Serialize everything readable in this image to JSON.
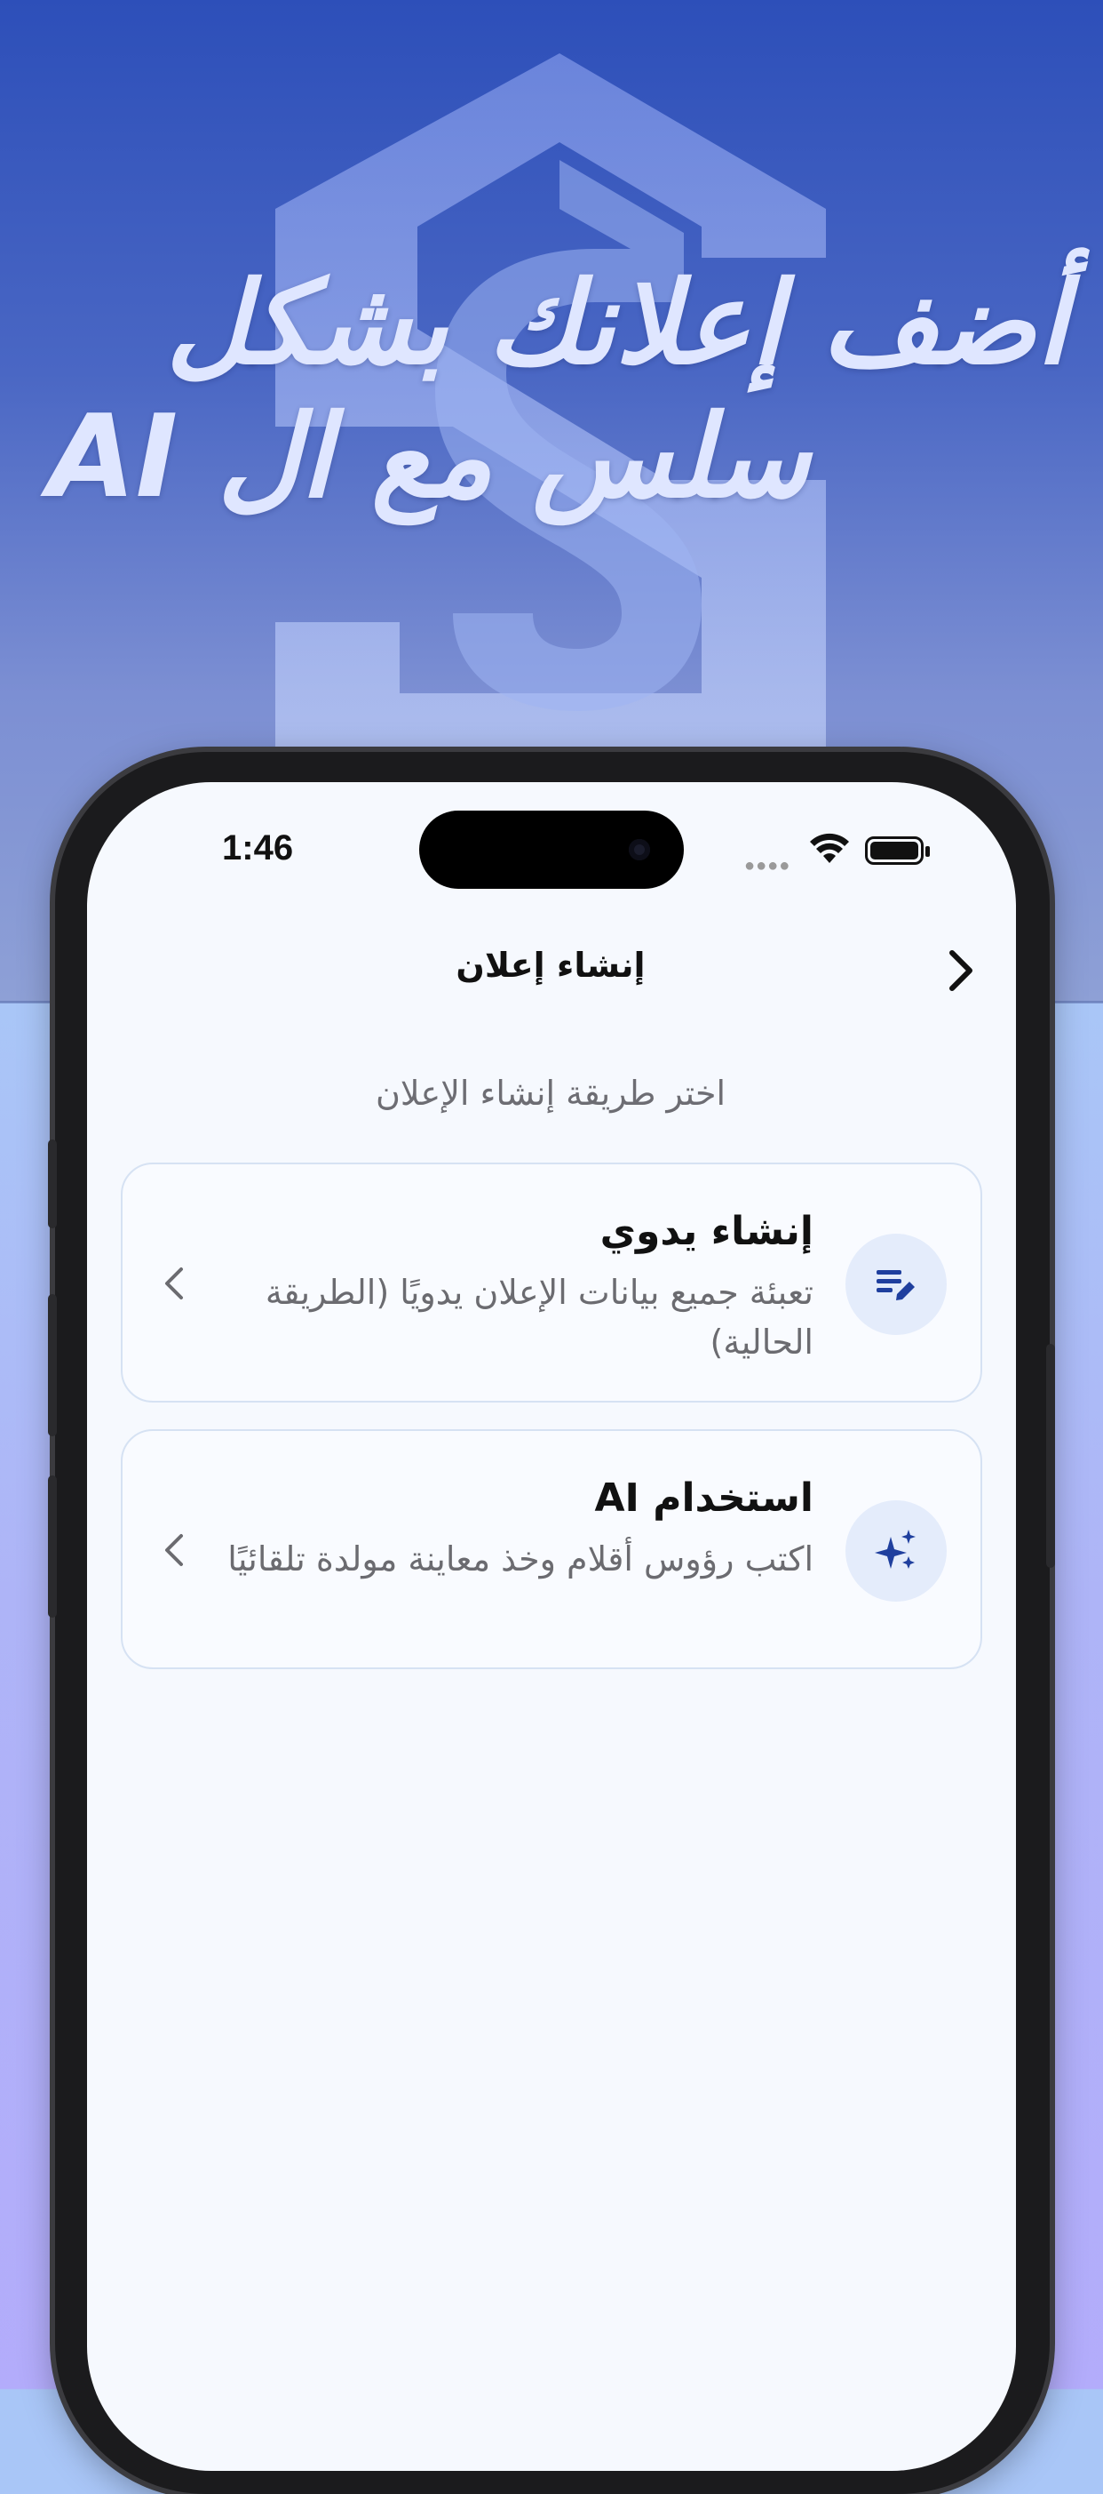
{
  "hero": {
    "headline_line1": "أضف إعلانك بشكل",
    "headline_line2": "سلس مع ال AI",
    "logo_icon": "s-hexagon-logo"
  },
  "status_bar": {
    "time": "1:46",
    "icons": [
      "cellular-dots-icon",
      "wifi-icon",
      "battery-icon"
    ]
  },
  "nav": {
    "title": "إنشاء إعلان",
    "back_icon": "chevron-right-icon"
  },
  "subtitle": "اختر طريقة إنشاء الإعلان",
  "options": [
    {
      "title": "إنشاء يدوي",
      "description": "تعبئة جميع بيانات الإعلان يدويًا (الطريقة الحالية)",
      "icon": "edit-list-icon",
      "chevron_icon": "chevron-left-icon"
    },
    {
      "title": "استخدام AI",
      "description": "اكتب رؤوس أقلام وخذ معاينة مولدة تلقائيًا",
      "icon": "sparkles-icon",
      "chevron_icon": "chevron-left-icon"
    }
  ],
  "colors": {
    "hero_top": "#2d4fb9",
    "accent_icon": "#1f3f9e",
    "card_border": "#d6e2f3",
    "screen_bg": "#f6f9fe"
  }
}
